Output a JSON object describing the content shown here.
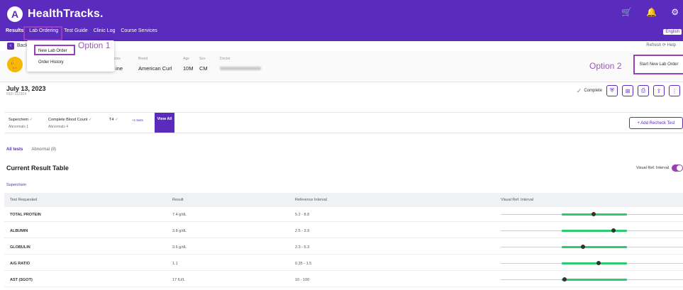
{
  "header": {
    "brand_initial": "A",
    "brand_name": "HealthTracks.",
    "icons": [
      "cart-icon",
      "bell-icon",
      "gear-icon"
    ],
    "nav": [
      "Results",
      "Lab Ordering",
      "Test Guide",
      "Clinic Log",
      "Course Services"
    ],
    "language": "English"
  },
  "crumb": {
    "back_label": "Back",
    "refresh_label": "Refresh ⟳   Help"
  },
  "dropdown": {
    "items": [
      "New Lab Order",
      "Order History"
    ],
    "option1_label": "Option 1"
  },
  "patient": {
    "labels": [
      "Species",
      "Breed",
      "Age",
      "Sex",
      "Doctor"
    ],
    "species_suffix": "ine",
    "breed": "American Curl",
    "age": "10M",
    "sex": "CM",
    "option2_label": "Option 2",
    "start_button": "Start New Lab Order"
  },
  "order": {
    "date": "July 13, 2023",
    "date_sub": "REF-112304",
    "status": "Complete",
    "actions": [
      "shield-icon",
      "chart-icon",
      "print-icon",
      "share-icon",
      "more-icon"
    ]
  },
  "tests": {
    "items": [
      {
        "name": "Superchem",
        "sub": "Abnormals 1"
      },
      {
        "name": "Complete Blood Count",
        "sub": "Abnormals 4"
      },
      {
        "name": "T4",
        "sub": ""
      }
    ],
    "more_link": "+1 tests",
    "view_all": "View All",
    "add_recheck": "+ Add Recheck Test"
  },
  "tabs": [
    "All tests",
    "Abnormal (8)"
  ],
  "table": {
    "title": "Current Result Table",
    "toggle_label": "Visual Ref. Interval",
    "group": "Superchem",
    "headers": [
      "Test Requested",
      "Result",
      "Reference Interval",
      "Visual Ref. Interval"
    ],
    "rows": [
      {
        "test": "TOTAL PROTEIN",
        "result": "7.4 g/dL",
        "ref": "5.2 - 8.8",
        "pos": 0.49
      },
      {
        "test": "ALBUMIN",
        "result": "3.8 g/dL",
        "ref": "2.5 - 3.9",
        "pos": 0.79
      },
      {
        "test": "GLOBULIN",
        "result": "3.6 g/dL",
        "ref": "2.3 - 5.3",
        "pos": 0.33
      },
      {
        "test": "A/G RATIO",
        "result": "1.1",
        "ref": "0.35 - 1.5",
        "pos": 0.57
      },
      {
        "test": "AST (SGOT)",
        "result": "17 IU/L",
        "ref": "10 - 100",
        "pos": 0.04
      }
    ]
  }
}
